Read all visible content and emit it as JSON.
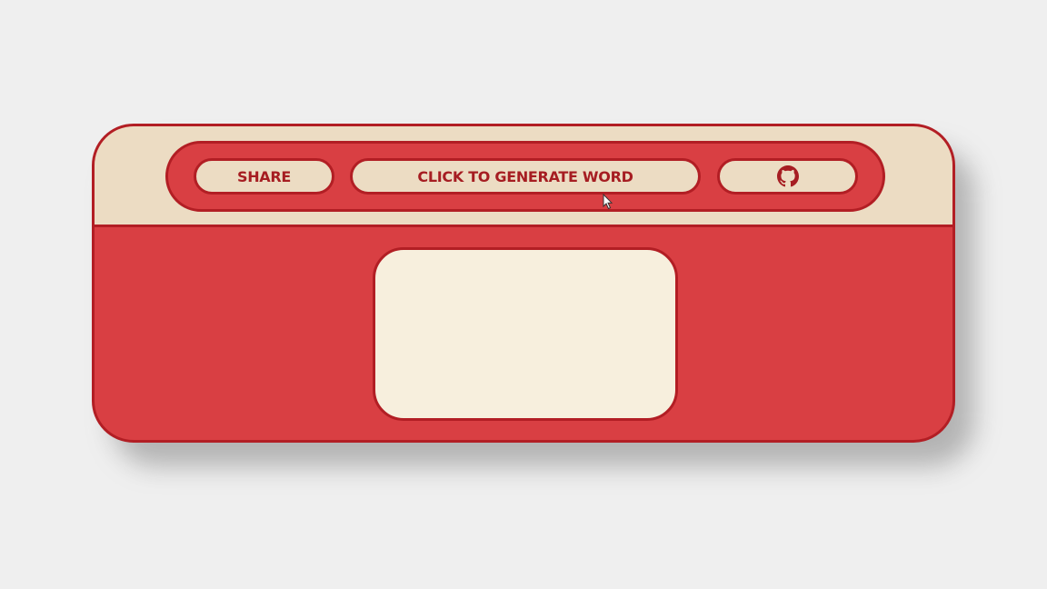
{
  "toolbar": {
    "share_label": "SHARE",
    "generate_label": "CLICK TO GENERATE WORD",
    "github_icon": "github-icon"
  },
  "word_display": {
    "text": ""
  },
  "colors": {
    "background": "#efefef",
    "card_red": "#d93f43",
    "outline_red": "#b21e24",
    "label_red": "#a61d22",
    "cream": "#ecdcc3",
    "light_cream": "#f7efdd"
  }
}
